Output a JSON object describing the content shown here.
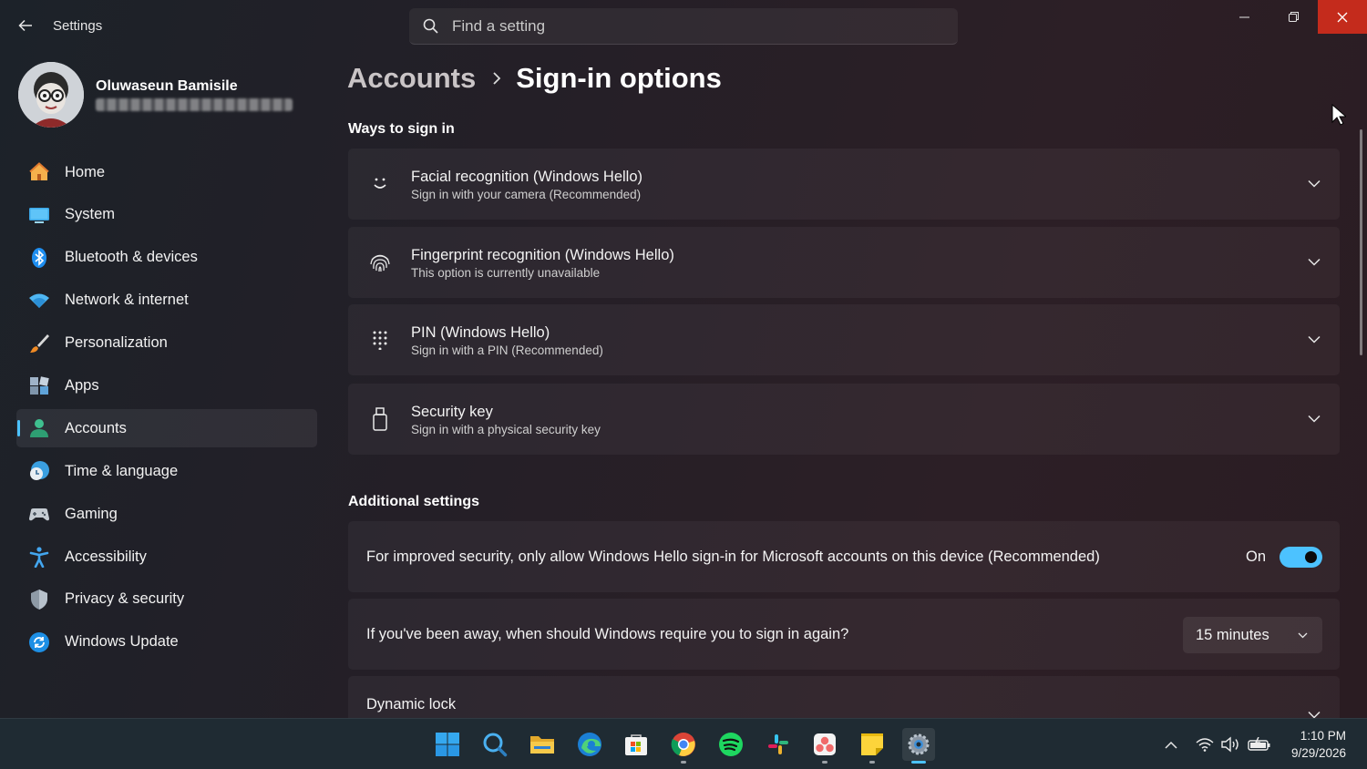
{
  "app": {
    "title": "Settings",
    "search_placeholder": "Find a setting"
  },
  "user": {
    "name": "Oluwaseun Bamisile"
  },
  "sidebar": {
    "items": [
      {
        "label": "Home",
        "icon": "home-icon"
      },
      {
        "label": "System",
        "icon": "system-icon"
      },
      {
        "label": "Bluetooth & devices",
        "icon": "bluetooth-icon"
      },
      {
        "label": "Network & internet",
        "icon": "wifi-icon"
      },
      {
        "label": "Personalization",
        "icon": "brush-icon"
      },
      {
        "label": "Apps",
        "icon": "apps-icon"
      },
      {
        "label": "Accounts",
        "icon": "person-icon",
        "active": true
      },
      {
        "label": "Time & language",
        "icon": "clock-globe-icon"
      },
      {
        "label": "Gaming",
        "icon": "gamepad-icon"
      },
      {
        "label": "Accessibility",
        "icon": "accessibility-icon"
      },
      {
        "label": "Privacy & security",
        "icon": "shield-icon"
      },
      {
        "label": "Windows Update",
        "icon": "update-icon"
      }
    ]
  },
  "breadcrumb": {
    "parent": "Accounts",
    "current": "Sign-in options"
  },
  "ways_section": {
    "title": "Ways to sign in",
    "items": [
      {
        "title": "Facial recognition (Windows Hello)",
        "subtitle": "Sign in with your camera (Recommended)",
        "icon": "face-icon"
      },
      {
        "title": "Fingerprint recognition (Windows Hello)",
        "subtitle": "This option is currently unavailable",
        "icon": "fingerprint-icon"
      },
      {
        "title": "PIN (Windows Hello)",
        "subtitle": "Sign in with a PIN (Recommended)",
        "icon": "pin-keypad-icon"
      },
      {
        "title": "Security key",
        "subtitle": "Sign in with a physical security key",
        "icon": "usb-key-icon"
      }
    ]
  },
  "additional": {
    "title": "Additional settings",
    "hello_only": {
      "label": "For improved security, only allow Windows Hello sign-in for Microsoft accounts on this device (Recommended)",
      "state_label": "On",
      "enabled": true
    },
    "away": {
      "label": "If you've been away, when should Windows require you to sign in again?",
      "value": "15 minutes"
    },
    "dynamic_lock": {
      "label": "Dynamic lock"
    }
  },
  "taskbar": {
    "apps": [
      {
        "name": "start",
        "icon": "windows-start-icon"
      },
      {
        "name": "search",
        "icon": "search-icon"
      },
      {
        "name": "file-explorer",
        "icon": "folder-icon"
      },
      {
        "name": "edge",
        "icon": "edge-icon"
      },
      {
        "name": "microsoft-store",
        "icon": "store-icon"
      },
      {
        "name": "chrome",
        "icon": "chrome-icon"
      },
      {
        "name": "spotify",
        "icon": "spotify-icon"
      },
      {
        "name": "slack",
        "icon": "slack-icon"
      },
      {
        "name": "asana",
        "icon": "asana-icon"
      },
      {
        "name": "sticky-notes",
        "icon": "sticky-notes-icon"
      },
      {
        "name": "settings",
        "icon": "settings-gear-icon",
        "active": true
      }
    ],
    "clock": {
      "time": "1:10 PM",
      "date": "9/29/2026"
    }
  },
  "colors": {
    "accent": "#4cc2ff",
    "close": "#c42b1c",
    "taskbar": "#1f2b33"
  }
}
